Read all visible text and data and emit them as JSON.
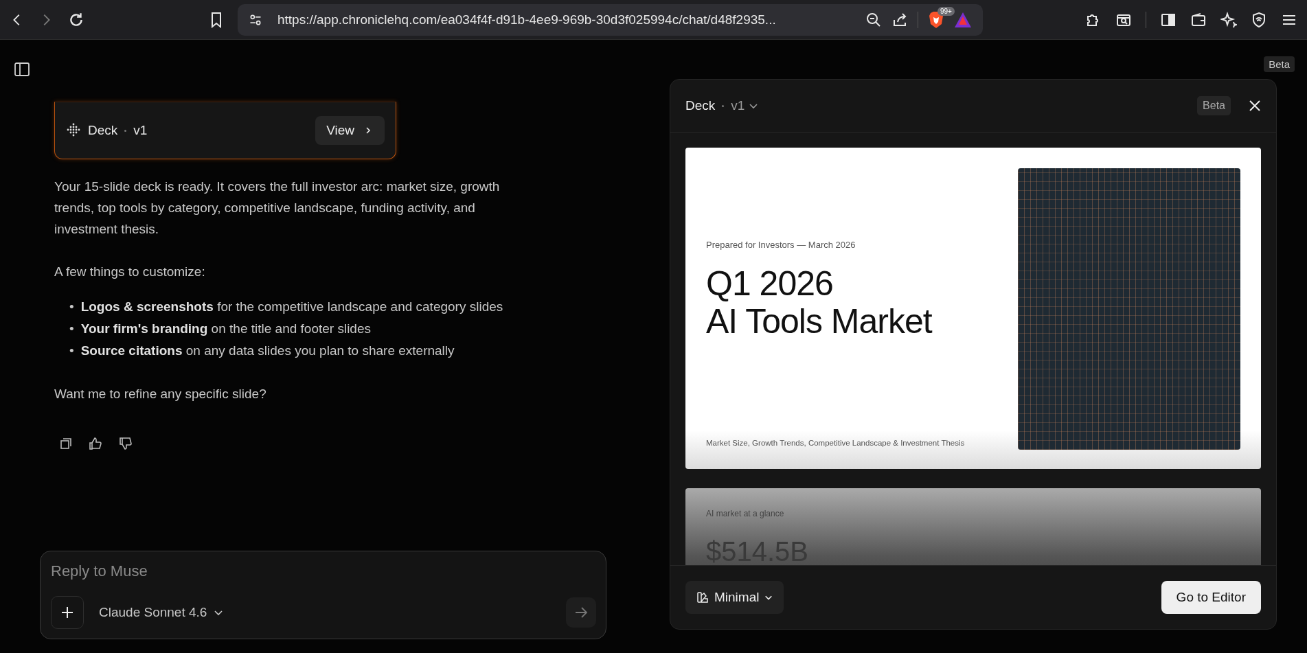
{
  "browser": {
    "nav": [
      {
        "kind": "back",
        "disabled": false
      },
      {
        "kind": "forward",
        "disabled": true
      },
      {
        "kind": "reload",
        "disabled": false
      }
    ],
    "url": "https://app.chroniclehq.com/ea034f4f-d91b-4ee9-969b-30d3f025994c/chat/d48f2935...",
    "shield_badge": "99+"
  },
  "page_badge": "Beta",
  "chat": {
    "artifact": {
      "title": "Deck",
      "version": "v1",
      "button": "View"
    },
    "intro": "Your 15-slide deck is ready. It covers the full investor arc: market size, growth trends, top tools by category, competitive landscape, funding activity, and investment thesis.",
    "list_heading": "A few things to customize:",
    "bullets": [
      {
        "marker": "•",
        "text": "**Logos & screenshots** for the competitive landscape and category slides"
      },
      {
        "marker": "•",
        "text": "**Your firm's branding** on the title and footer slides"
      },
      {
        "marker": "•",
        "text": "**Source citations** on any data slides you plan to share externally"
      }
    ],
    "question": "Want me to refine any specific slide?",
    "composer": {
      "placeholder": "Reply to Muse",
      "model": "Claude Sonnet 4.6"
    }
  },
  "panel": {
    "title": "Deck",
    "version": "v1",
    "badge": "Beta",
    "slides": [
      {
        "kind": "title",
        "eyebrow": "Prepared for Investors — March 2026",
        "heading": [
          "Q1 2026",
          "AI Tools Market"
        ],
        "footer": "Market Size, Growth Trends, Competitive Landscape & Investment Thesis"
      },
      {
        "kind": "stat",
        "eyebrow": "AI market at a glance",
        "value": "$514.5B"
      }
    ],
    "theme": "Minimal",
    "primary": "Go to Editor"
  }
}
